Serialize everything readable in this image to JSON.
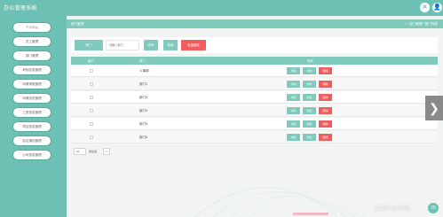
{
  "app": {
    "title": "办公管理系统"
  },
  "topbar": {
    "close_icon": "✕",
    "user_icon": "👤"
  },
  "sidebar": {
    "items": [
      {
        "label": "个人中心"
      },
      {
        "label": "员工管理"
      },
      {
        "label": "部门管理"
      },
      {
        "label": "考勤信息管理"
      },
      {
        "label": "申请请假管理"
      },
      {
        "label": "申请加班管理"
      },
      {
        "label": "工资信息管理"
      },
      {
        "label": "项目信息管理"
      },
      {
        "label": "会议通知管理"
      },
      {
        "label": "公司信息管理"
      }
    ]
  },
  "breadcrumb": {
    "left": "部门管理",
    "right": "⌂ / 部门管理 / 部门列表"
  },
  "filter": {
    "label": "部门",
    "placeholder": "请输入部门",
    "search_button": "查询",
    "add_button": "新增",
    "batch_delete_button": "批量删除"
  },
  "table": {
    "columns": [
      "索引",
      "部门",
      "操作"
    ],
    "rows": [
      {
        "name": "人事部"
      },
      {
        "name": "部门2"
      },
      {
        "name": "部门3"
      },
      {
        "name": "部门4"
      },
      {
        "name": "部门5"
      },
      {
        "name": "部门6"
      }
    ],
    "row_actions": {
      "detail": "详情",
      "edit": "修改",
      "delete": "删除"
    }
  },
  "pager": {
    "page_size": "10",
    "goto_label": "前往第",
    "page": "1"
  },
  "watermark": "CSDN @CK55",
  "colors": {
    "accent": "#6cc1b4",
    "danger": "#f35c5c"
  }
}
